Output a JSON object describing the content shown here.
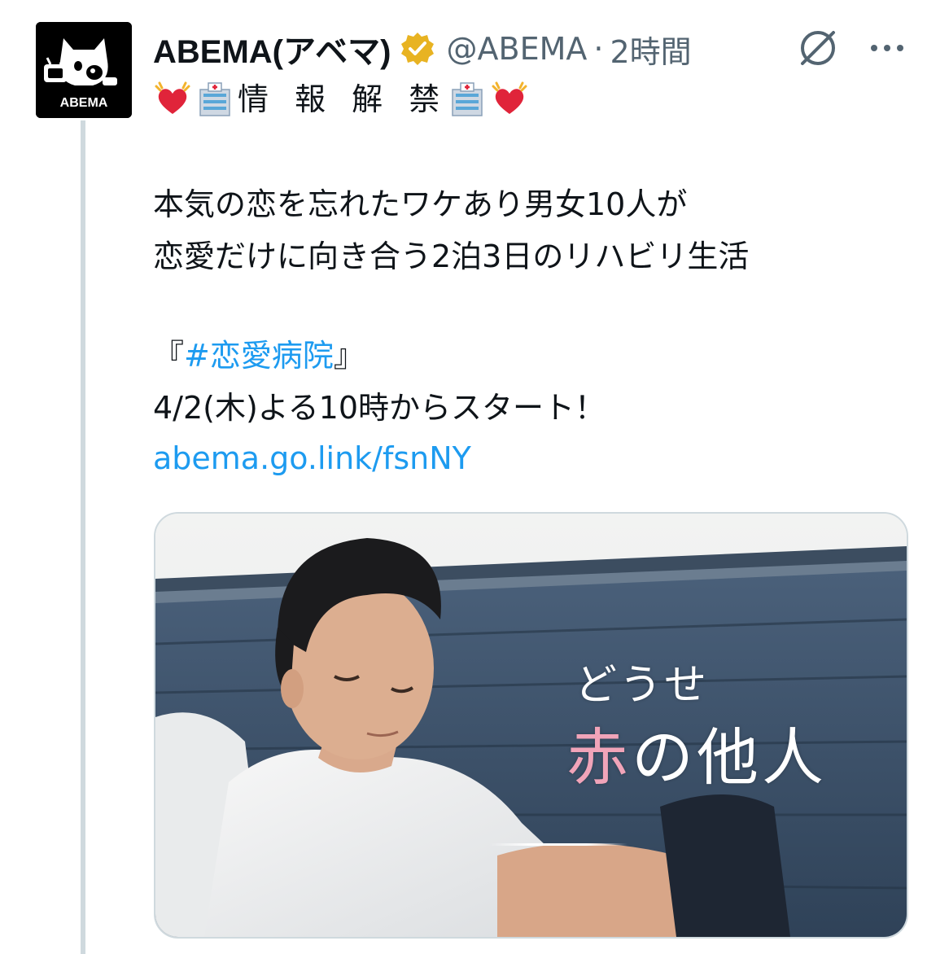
{
  "author": {
    "display_name": "ABEMA(アベマ)",
    "handle": "@ABEMA",
    "separator": "·",
    "time": "2時間",
    "avatar_label": "ABEMA",
    "verified_color": "#e8b322"
  },
  "icons": {
    "grok": "grok-icon",
    "more": "more-icon"
  },
  "tweet": {
    "announce_label": "情 報 解 禁",
    "line1": "本気の恋を忘れたワケあり男女10人が",
    "line2": "恋愛だけに向き合う2泊3日のリハビリ生活",
    "hashtag_open": "『",
    "hashtag": "#恋愛病院",
    "hashtag_close": "』",
    "schedule": "4/2(木)よる10時からスタート！",
    "link": "abema.go.link/fsnNY"
  },
  "media": {
    "overlay_small": "どうせ",
    "overlay_accent": "赤",
    "overlay_rest": "の他人",
    "accent_color": "#f1a4b9"
  },
  "colors": {
    "link": "#1d9bf0",
    "secondary_text": "#536471"
  }
}
